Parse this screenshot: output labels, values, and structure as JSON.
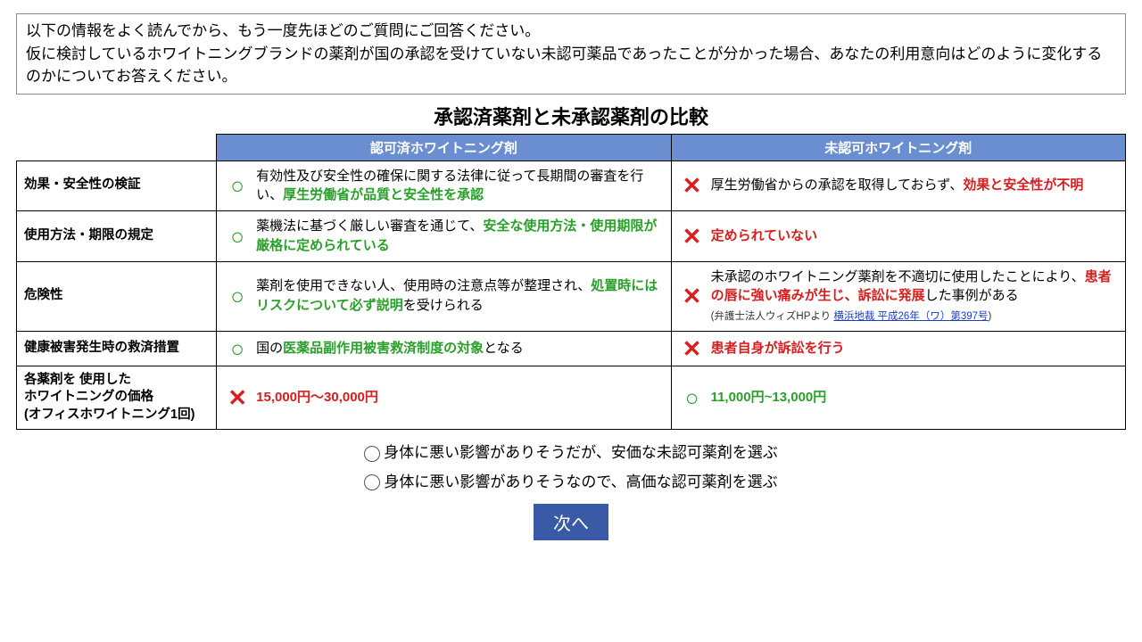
{
  "intro": {
    "line1": "以下の情報をよく読んでから、もう一度先ほどのご質問にご回答ください。",
    "line2": "仮に検討しているホワイトニングブランドの薬剤が国の承認を受けていない未認可薬品であったことが分かった場合、あなたの利用意向はどのように変化するのかについてお答えください。"
  },
  "title": "承認済薬剤と未承認薬剤の比較",
  "columns": {
    "approved": "認可済ホワイトニング剤",
    "unapproved": "未認可ホワイトニング剤"
  },
  "rows": {
    "r1": {
      "label": "効果・安全性の検証",
      "approved": {
        "mark": "○",
        "pre": "有効性及び安全性の確保に関する法律に従って長期間の審査を行い、",
        "em": "厚生労働省が品質と安全性を承認"
      },
      "unapproved": {
        "mark": "✕",
        "pre": "厚生労働省からの承認を取得しておらず、",
        "em": "効果と安全性が不明"
      }
    },
    "r2": {
      "label": "使用方法・期限の規定",
      "approved": {
        "mark": "○",
        "pre": "薬機法に基づく厳しい審査を通じて、",
        "em": "安全な使用方法・使用期限が厳格に定められている"
      },
      "unapproved": {
        "mark": "✕",
        "em": "定められていない"
      }
    },
    "r3": {
      "label": "危険性",
      "approved": {
        "mark": "○",
        "pre": "薬剤を使用できない人、使用時の注意点等が整理され、",
        "em": "処置時にはリスクについて必ず説明",
        "post": "を受けられる"
      },
      "unapproved": {
        "mark": "✕",
        "pre": "未承認のホワイトニング薬剤を不適切に使用したことにより、",
        "em": "患者の唇に強い痛みが生じ、訴訟に発展",
        "post": "した事例がある",
        "src_label": "(弁護士法人ウィズHPより ",
        "src_link": "横浜地裁 平成26年（ワ）第397号",
        "src_close": ")"
      }
    },
    "r4": {
      "label": "健康被害発生時の救済措置",
      "approved": {
        "mark": "○",
        "pre": "国の",
        "em": "医薬品副作用被害救済制度の対象",
        "post": "となる"
      },
      "unapproved": {
        "mark": "✕",
        "em": "患者自身が訴訟を行う"
      }
    },
    "r5": {
      "label_line1": "各薬剤を 使用した",
      "label_line2": "ホワイトニングの価格",
      "label_line3": "(オフィスホワイトニング1回)",
      "approved": {
        "mark": "✕",
        "em": "15,000円～30,000円"
      },
      "unapproved": {
        "mark": "○",
        "em": "11,000円~13,000円"
      }
    }
  },
  "options": {
    "opt1": "身体に悪い影響がありそうだが、安価な未認可薬剤を選ぶ",
    "opt2": "身体に悪い影響がありそうなので、高価な認可薬剤を選ぶ"
  },
  "next_button": "次へ"
}
